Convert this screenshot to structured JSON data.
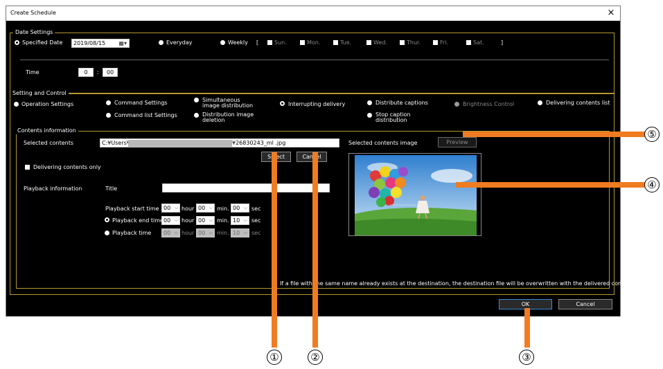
{
  "window": {
    "title": "Create Schedule",
    "close_glyph": "×"
  },
  "date_settings": {
    "label": "Date Settings",
    "specified_date_label": "Specified Date",
    "date_value": "2019/08/15",
    "everyday_label": "Everyday",
    "weekly_label": "Weekly",
    "bracket_open": "[",
    "bracket_close": "]",
    "days": [
      "Sun.",
      "Mon.",
      "Tue.",
      "Wed.",
      "Thur.",
      "Fri.",
      "Sat."
    ],
    "time_label": "Time",
    "time_hour": "0",
    "time_sep": ":",
    "time_min": "00"
  },
  "setting_control": {
    "label": "Setting and Control",
    "operation_settings": "Operation Settings",
    "command_settings": "Command Settings",
    "command_list_settings": "Command list Settings",
    "simultaneous_1": "Simultaneous",
    "simultaneous_2": "image distribution",
    "distribution_deletion_1": "Distribution image",
    "distribution_deletion_2": "deletion",
    "interrupting_delivery": "Interrupting delivery",
    "distribute_captions": "Distribute captions",
    "stop_caption_1": "Stop caption",
    "stop_caption_2": "distribution",
    "brightness_control": "Brightness Control",
    "delivering_contents_list": "Delivering contents list"
  },
  "contents_info": {
    "label": "Contents information",
    "selected_contents_label": "Selected contents",
    "path_prefix": "C:¥Users¥",
    "path_suffix": "¥26830243_ml .jpg",
    "select_button": "Select",
    "cancel_button": "Cancel",
    "delivering_only": "Delivering contents only",
    "selected_image_label": "Selected contents image",
    "preview_button": "Preview",
    "playback_info": "Playback information",
    "title_label": "Title",
    "title_value": "",
    "start_time_label": "Playback start time",
    "end_time_label": "Playback end time",
    "playback_time_label": "Playback time",
    "hour": "hour",
    "min": "min.",
    "sec": "sec",
    "start": {
      "h": "00",
      "m": "00",
      "s": "00"
    },
    "end": {
      "h": "00",
      "m": "00",
      "s": "10"
    },
    "ptime": {
      "h": "00",
      "m": "00",
      "s": "10"
    },
    "note": "If a file with the same name already exists at the destination, the destination file will be overwritten with the delivered contents."
  },
  "footer": {
    "ok_button": "OK",
    "cancel_button": "Cancel"
  },
  "callouts": [
    "①",
    "②",
    "③",
    "④",
    "⑤"
  ],
  "colors": {
    "accent_orange": "#f07c22",
    "group_border": "#b59a2e",
    "background": "#000000"
  }
}
